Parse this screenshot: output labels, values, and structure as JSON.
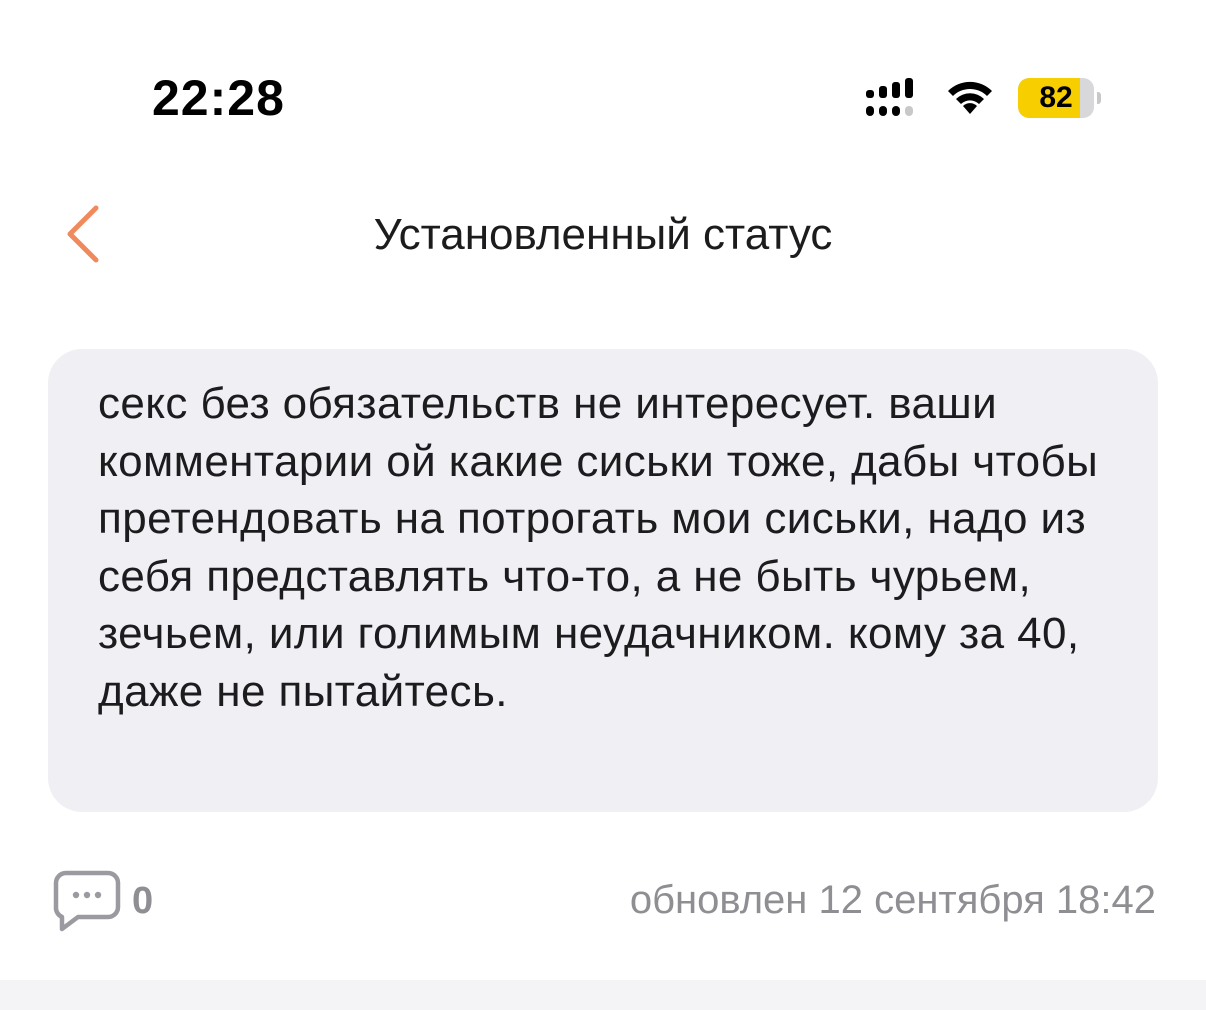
{
  "status_bar": {
    "time": "22:28",
    "battery_percent": "82",
    "battery_level": 0.82,
    "signal_icon": "cellular-signal-icon",
    "wifi_icon": "wifi-icon"
  },
  "header": {
    "title": "Установленный статус",
    "back_icon": "chevron-left-icon",
    "accent_color": "#f08a5d"
  },
  "status": {
    "text": "секс без обязательств не интересует. ваши комментарии ой какие сиськи тоже, дабы чтобы претендовать на потрогать мои сиськи, надо из себя представлять что-то, а не быть чурьем, зечьем, или голимым неудачником. кому за 40, даже не пытайтесь."
  },
  "footer": {
    "comment_icon": "comment-bubble-icon",
    "comments_count": "0",
    "updated_label": "обновлен 12 сентября 18:42"
  },
  "colors": {
    "card_background": "#f0f0f4",
    "battery_fill": "#f7ce00",
    "muted_text": "#8e8e93"
  }
}
